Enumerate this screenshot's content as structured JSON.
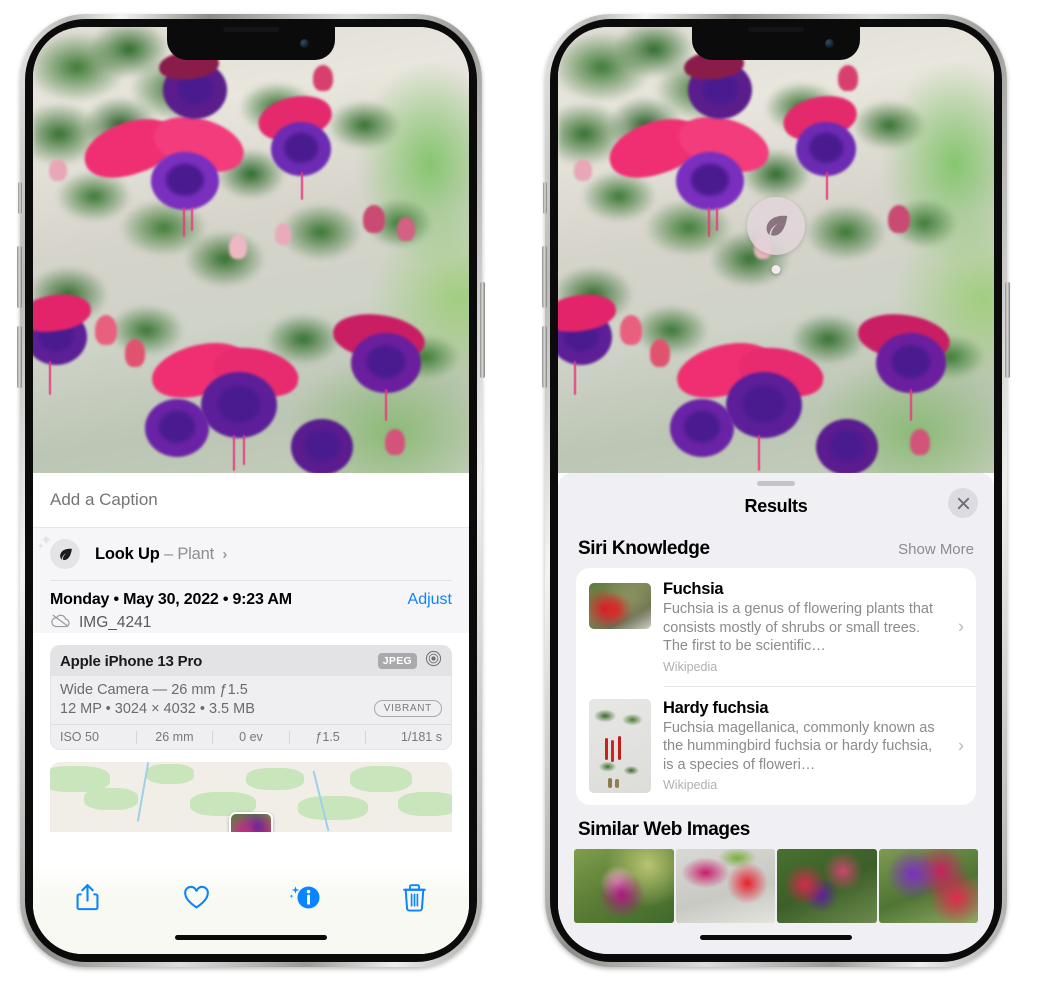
{
  "left_phone": {
    "name": "photos-detail-view",
    "photo": {
      "alt": "fuchsia-flowers-hanging-basket"
    },
    "caption": {
      "placeholder": "Add a Caption",
      "value": ""
    },
    "lookup": {
      "icon": "leaf-icon",
      "label": "Look Up",
      "separator": "–",
      "subject": "Plant",
      "chevron": "chevron-right-icon"
    },
    "metadata": {
      "date": "Monday • May 30, 2022 • 9:23 AM",
      "adjust_label": "Adjust",
      "cloud_icon": "icloud-slash-icon",
      "filename": "IMG_4241"
    },
    "camera_card": {
      "device": "Apple iPhone 13 Pro",
      "format_badge": "JPEG",
      "lens_icon": "aperture-icon",
      "lens_line": "Wide Camera — 26 mm ƒ1.5",
      "size_line": "12 MP • 3024 × 4032 • 3.5 MB",
      "style_badge": "VIBRANT",
      "exif": [
        "ISO 50",
        "26 mm",
        "0 ev",
        "ƒ1.5",
        "1/181 s"
      ]
    },
    "map": {
      "pin_alt": "photo-location-thumbnail"
    },
    "toolbar": [
      {
        "name": "share-icon",
        "label": "Share"
      },
      {
        "name": "heart-icon",
        "label": "Favorite"
      },
      {
        "name": "info-icon",
        "label": "Info"
      },
      {
        "name": "trash-icon",
        "label": "Delete"
      }
    ]
  },
  "right_phone": {
    "name": "visual-lookup-results-view",
    "photo_badge": {
      "icon": "leaf-icon"
    },
    "sheet": {
      "title": "Results",
      "close_icon": "close-icon",
      "siri_section": {
        "title": "Siri Knowledge",
        "show_more": "Show More",
        "items": [
          {
            "name": "Fuchsia",
            "description": "Fuchsia is a genus of flowering plants that consists mostly of shrubs or small trees. The first to be scientific…",
            "source": "Wikipedia",
            "thumb_alt": "red-fuchsia-flowers-thumbnail"
          },
          {
            "name": "Hardy fuchsia",
            "description": "Fuchsia magellanica, commonly known as the hummingbird fuchsia or hardy fuchsia, is a species of floweri…",
            "source": "Wikipedia",
            "thumb_alt": "fuchsia-magellanica-botanical-thumbnail"
          }
        ]
      },
      "similar_section": {
        "title": "Similar Web Images",
        "images": [
          {
            "alt": "pink-white-fuchsia-on-green"
          },
          {
            "alt": "red-fuchsia-closeup"
          },
          {
            "alt": "fuchsia-bush-with-buds"
          },
          {
            "alt": "purple-pink-fuchsia-cluster"
          }
        ]
      }
    }
  },
  "colors": {
    "accent_blue": "#0a84ff",
    "sheet_gray": "#f0eff4",
    "secondary_text": "#8a8a8f",
    "badge_gray": "#a9a9ae"
  }
}
